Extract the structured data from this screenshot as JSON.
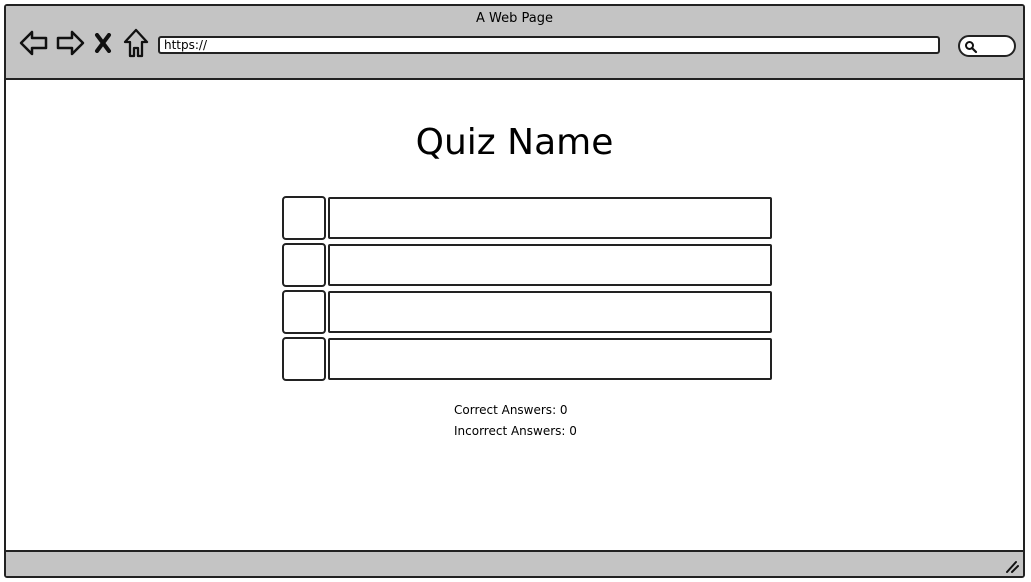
{
  "window": {
    "title": "A Web Page"
  },
  "toolbar": {
    "back_icon": "back-arrow-icon",
    "forward_icon": "forward-arrow-icon",
    "stop_icon": "close-icon",
    "home_icon": "home-icon",
    "address_value": "https://",
    "search_icon": "search-icon"
  },
  "quiz": {
    "title": "Quiz Name",
    "answers": [
      {
        "text": ""
      },
      {
        "text": ""
      },
      {
        "text": ""
      },
      {
        "text": ""
      }
    ],
    "correct_label": "Correct Answers: 0",
    "incorrect_label": "Incorrect Answers: 0"
  },
  "statusbar": {
    "resize_icon": "resize-grip-icon"
  }
}
